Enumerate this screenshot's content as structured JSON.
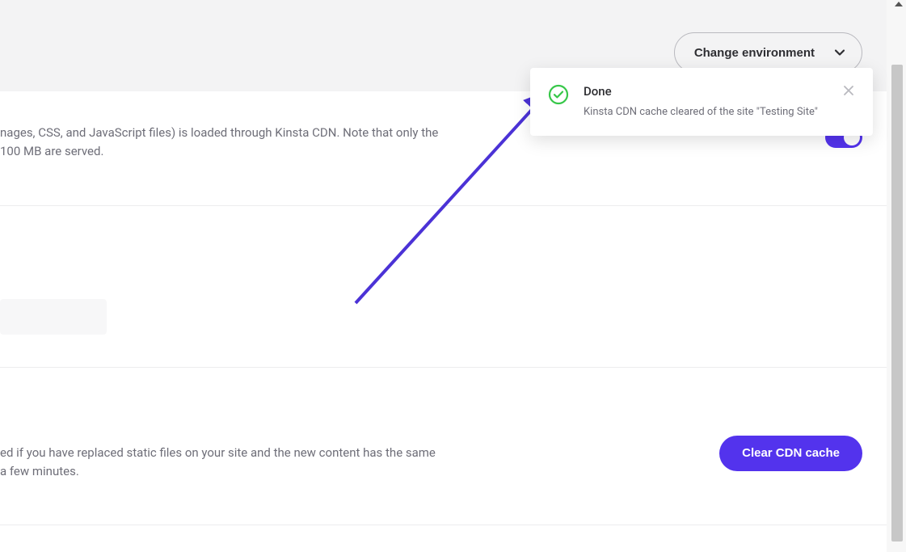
{
  "header": {
    "change_env_label": "Change environment"
  },
  "section1": {
    "line1": "nages, CSS, and JavaScript files) is loaded through Kinsta CDN. Note that only the",
    "line2": " 100 MB are served."
  },
  "section3": {
    "line1": "ed if you have replaced static files on your site and the new content has the same",
    "line2": "a few minutes.",
    "clear_button_label": "Clear CDN cache"
  },
  "toast": {
    "title": "Done",
    "message": "Kinsta CDN cache cleared of the site \"Testing Site\""
  },
  "colors": {
    "primary": "#5333ed",
    "success": "#37c749"
  }
}
